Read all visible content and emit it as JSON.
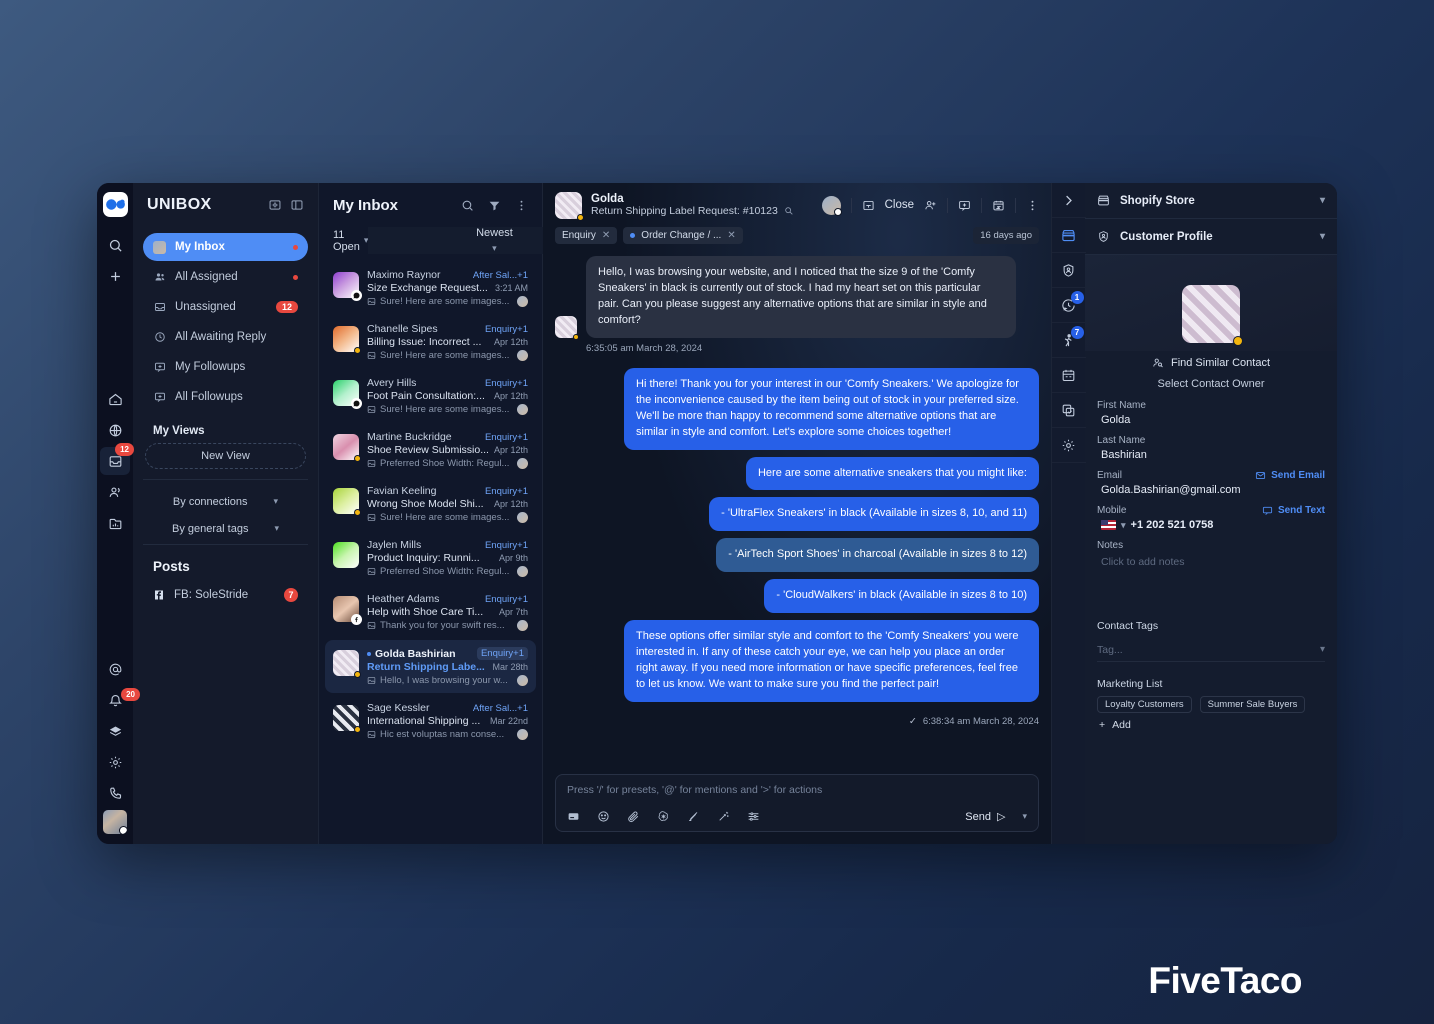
{
  "watermark": "FiveTaco",
  "rail": {
    "logo_icon": "unibox-logo-icon",
    "items": [
      {
        "name": "search-icon"
      },
      {
        "name": "plus-icon"
      },
      {
        "name": "home-icon"
      },
      {
        "name": "globe-icon"
      },
      {
        "name": "inbox-icon",
        "badge": "12"
      },
      {
        "name": "contacts-icon"
      },
      {
        "name": "reports-icon"
      },
      {
        "name": "mentions-icon"
      },
      {
        "name": "bell-icon",
        "badge": "20"
      },
      {
        "name": "layers-icon"
      },
      {
        "name": "gear-icon"
      },
      {
        "name": "phone-icon"
      }
    ]
  },
  "nav": {
    "title": "UNIBOX",
    "header_icons": [
      "archive-gear-icon",
      "panel-toggle-icon"
    ],
    "items": [
      {
        "label": "My Inbox",
        "icon": "avatar-icon",
        "selected": true,
        "indicator": "dot"
      },
      {
        "label": "All Assigned",
        "icon": "users-icon",
        "indicator": "dot"
      },
      {
        "label": "Unassigned",
        "icon": "inbox-tray-icon",
        "badge": "12"
      },
      {
        "label": "All Awaiting Reply",
        "icon": "clock-icon"
      },
      {
        "label": "My Followups",
        "icon": "message-plus-icon"
      },
      {
        "label": "All Followups",
        "icon": "message-plus-icon"
      }
    ],
    "views_heading": "My Views",
    "new_view_label": "New View",
    "group_by": [
      {
        "label": "By connections"
      },
      {
        "label": "By general tags"
      }
    ],
    "posts_heading": "Posts",
    "posts": [
      {
        "label": "FB: SoleStride",
        "icon": "facebook-icon",
        "badge": "7"
      }
    ]
  },
  "list": {
    "title": "My Inbox",
    "header_icons": [
      "search-icon",
      "filter-icon",
      "more-vertical-icon"
    ],
    "status_filter": "11 Open",
    "sort": "Newest",
    "rows": [
      {
        "name": "Maximo Raynor",
        "tag": "After Sal...+1",
        "subject": "Size Exchange Request...",
        "time": "3:21 AM",
        "preview": "Sure! Here are some images...",
        "channel": "whatsapp",
        "avatar": "linear-gradient(140deg,#8e3fd0,#c89adf 45%,#ffffff)",
        "active": false
      },
      {
        "name": "Chanelle Sipes",
        "tag": "Enquiry+1",
        "subject": "Billing Issue: Incorrect ...",
        "time": "Apr 12th",
        "preview": "Sure! Here are some images...",
        "channel": "dot",
        "avatar": "linear-gradient(140deg,#e06a2b,#f3b98c 50%,#ffffff)",
        "active": false
      },
      {
        "name": "Avery Hills",
        "tag": "Enquiry+1",
        "subject": "Foot Pain Consultation:...",
        "time": "Apr 12th",
        "preview": "Sure! Here are some images...",
        "channel": "whatsapp",
        "avatar": "linear-gradient(140deg,#29d06a,#b3f0cd 50%,#ffffff)",
        "active": false
      },
      {
        "name": "Martine Buckridge",
        "tag": "Enquiry+1",
        "subject": "Shoe Review Submissio...",
        "time": "Apr 12th",
        "preview": "Preferred Shoe Width: Regul...",
        "channel": "dot",
        "avatar": "linear-gradient(140deg,#f0d6e2,#d98fae 50%,#ffffff)",
        "active": false
      },
      {
        "name": "Favian Keeling",
        "tag": "Enquiry+1",
        "subject": "Wrong Shoe Model Shi...",
        "time": "Apr 12th",
        "preview": "Sure! Here are some images...",
        "channel": "dot",
        "avatar": "linear-gradient(140deg,#a8d33a,#dcefa0 50%,#ffffff)",
        "active": false
      },
      {
        "name": "Jaylen Mills",
        "tag": "Enquiry+1",
        "subject": "Product Inquiry: Runni...",
        "time": "Apr 9th",
        "preview": "Preferred Shoe Width: Regul...",
        "channel": "none",
        "avatar": "linear-gradient(140deg,#4ce01f,#c9f5b0 50%,#ffffff)",
        "active": false
      },
      {
        "name": "Heather Adams",
        "tag": "Enquiry+1",
        "subject": "Help with Shoe Care Ti...",
        "time": "Apr 7th",
        "preview": "Thank you for your swift res...",
        "channel": "facebook",
        "avatar": "linear-gradient(140deg,#b58c74,#e8c6b0 50%,#6a4a3a)",
        "active": false
      },
      {
        "name": "Golda Bashirian",
        "tag": "Enquiry+1",
        "subject": "Return Shipping Labe...",
        "time": "Mar 28th",
        "preview": "Hello, I was browsing your w...",
        "channel": "dot",
        "avatar": "linear-gradient(140deg,#e6dfea,#cdbcd0 50%,#ffffff)",
        "active": true
      },
      {
        "name": "Sage Kessler",
        "tag": "After Sal...+1",
        "subject": "International Shipping ...",
        "time": "Mar 22nd",
        "preview": "Hic est voluptas nam conse...",
        "channel": "dot",
        "avatar": "linear-gradient(140deg,#2a3140,#e8eaf0 50%,#9aa3b4)",
        "active": false
      }
    ]
  },
  "conversation": {
    "contact_name": "Golda",
    "subject": "Return Shipping Label Request: #10123",
    "subject_icon": "search-small-icon",
    "close_label": "Close",
    "action_icons": [
      "assignee-avatar",
      "archive-icon",
      "add-person-icon",
      "followup-icon",
      "snooze-icon",
      "more-vertical-icon"
    ],
    "tags": [
      {
        "label": "Enquiry",
        "dot": false
      },
      {
        "label": "Order Change / ...",
        "dot": true
      }
    ],
    "age": "16 days ago",
    "messages": [
      {
        "direction": "in",
        "text": "Hello, I was browsing your website, and I noticed that the size 9 of the 'Comfy Sneakers' in black is currently out of stock. I had my heart set on this particular pair. Can you please suggest any alternative options that are similar in style and comfort?",
        "time": "6:35:05 am March 28, 2024"
      },
      {
        "direction": "out",
        "text": "Hi there! Thank you for your interest in our 'Comfy Sneakers.' We apologize for the inconvenience caused by the item being out of stock in your preferred size. We'll be more than happy to recommend some alternative options that are similar in style and comfort. Let's explore some choices together!",
        "style": "primary"
      },
      {
        "direction": "out",
        "text": "Here are some alternative sneakers that you might like:",
        "style": "primary"
      },
      {
        "direction": "out",
        "text": "- 'UltraFlex Sneakers' in black (Available in sizes 8, 10, and 11)",
        "style": "primary"
      },
      {
        "direction": "out",
        "text": "- 'AirTech Sport Shoes' in charcoal (Available in sizes 8 to 12)",
        "style": "alt"
      },
      {
        "direction": "out",
        "text": "- 'CloudWalkers' in black (Available in sizes 8 to 10)",
        "style": "primary"
      },
      {
        "direction": "out",
        "text": "These options offer similar style and comfort to the 'Comfy Sneakers' you were interested in. If any of these catch your eye, we can help you place an order right away. If you need more information or have specific preferences, feel free to let us know. We want to make sure you find the perfect pair!",
        "style": "primary",
        "time": "6:38:34 am March 28, 2024",
        "status": "sent"
      }
    ],
    "composer": {
      "placeholder": "Press '/' for presets, '@' for mentions and '>' for actions",
      "tool_icons": [
        "note-icon",
        "emoji-icon",
        "attachment-icon",
        "openai-icon",
        "signature-icon",
        "magic-wand-icon",
        "settings-sliders-icon"
      ],
      "send_label": "Send"
    }
  },
  "strip": {
    "items": [
      {
        "name": "expand-panel-icon"
      },
      {
        "name": "storefront-icon",
        "accent": true
      },
      {
        "name": "shield-person-icon"
      },
      {
        "name": "history-clock-icon",
        "badge": "1"
      },
      {
        "name": "activity-walk-icon",
        "badge": "7"
      },
      {
        "name": "calendar-icon"
      },
      {
        "name": "tasks-icon"
      },
      {
        "name": "gear-icon"
      }
    ]
  },
  "right_panel": {
    "sections": [
      {
        "title": "Shopify Store",
        "icon": "storefront-icon"
      },
      {
        "title": "Customer Profile",
        "icon": "shield-person-icon"
      }
    ],
    "find_similar_label": "Find Similar Contact",
    "select_owner_label": "Select Contact Owner",
    "fields": {
      "first_name_label": "First Name",
      "first_name_value": "Golda",
      "last_name_label": "Last Name",
      "last_name_value": "Bashirian",
      "email_label": "Email",
      "email_action": "Send Email",
      "email_value": "Golda.Bashirian@gmail.com",
      "mobile_label": "Mobile",
      "mobile_action": "Send Text",
      "mobile_value": "+1 202 521 0758",
      "notes_label": "Notes",
      "notes_placeholder": "Click to add notes",
      "contact_tags_label": "Contact Tags",
      "contact_tags_placeholder": "Tag...",
      "marketing_list_label": "Marketing List",
      "marketing_list_tags": [
        "Loyalty Customers",
        "Summer Sale Buyers"
      ],
      "add_label": "Add"
    }
  },
  "colors": {
    "accent_blue": "#4f8df5",
    "bubble_out": "#2760e8",
    "badge_red": "#e8483f",
    "status_yellow": "#f3b50e"
  }
}
